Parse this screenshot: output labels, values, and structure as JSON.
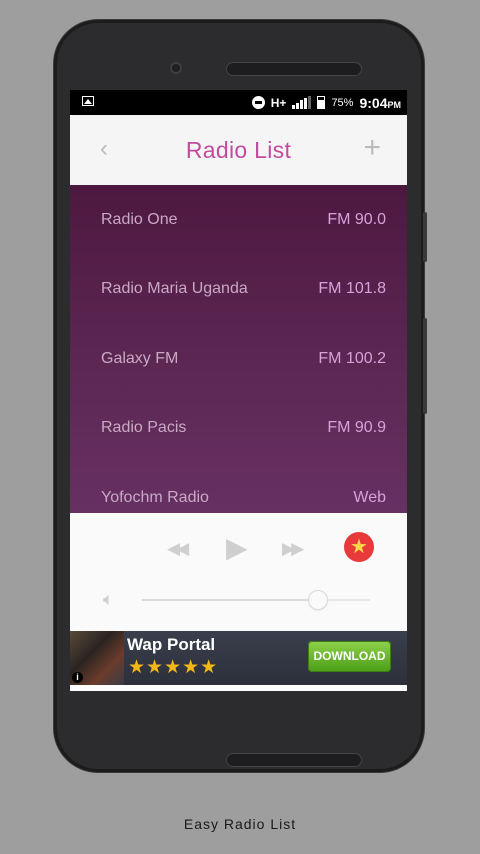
{
  "status_bar": {
    "network": "H+",
    "battery_percent": "75%",
    "time": "9:04",
    "ampm": "PM"
  },
  "header": {
    "back_glyph": "‹",
    "title": "Radio List",
    "add_glyph": "+"
  },
  "stations": [
    {
      "name": "Radio One",
      "frequency": "FM 90.0"
    },
    {
      "name": "Radio Maria Uganda",
      "frequency": "FM 101.8"
    },
    {
      "name": "Galaxy FM",
      "frequency": "FM 100.2"
    },
    {
      "name": "Radio Pacis",
      "frequency": "FM 90.9"
    },
    {
      "name": "Yofochm Radio",
      "frequency": "Web"
    }
  ],
  "player": {
    "prev_icon": "skip-previous-icon",
    "play_icon": "play-icon",
    "next_icon": "skip-next-icon",
    "favorite_icon": "star-icon",
    "volume_icon": "speaker-volume-icon",
    "volume_level": 0.77
  },
  "ad": {
    "title": "Wap Portal",
    "stars": "★★★★★",
    "button_label": "DOWNLOAD",
    "info_glyph": "i"
  },
  "caption": "Easy Radio List",
  "colors": {
    "title_accent": "#c24a9f",
    "list_bg_top": "#4d1840",
    "list_bg_bottom": "#673063",
    "station_name": "#c9a9c4",
    "station_freq": "#d6a2d8",
    "favorite_bg": "#e83a3a",
    "download_btn": "#6ab52f"
  }
}
